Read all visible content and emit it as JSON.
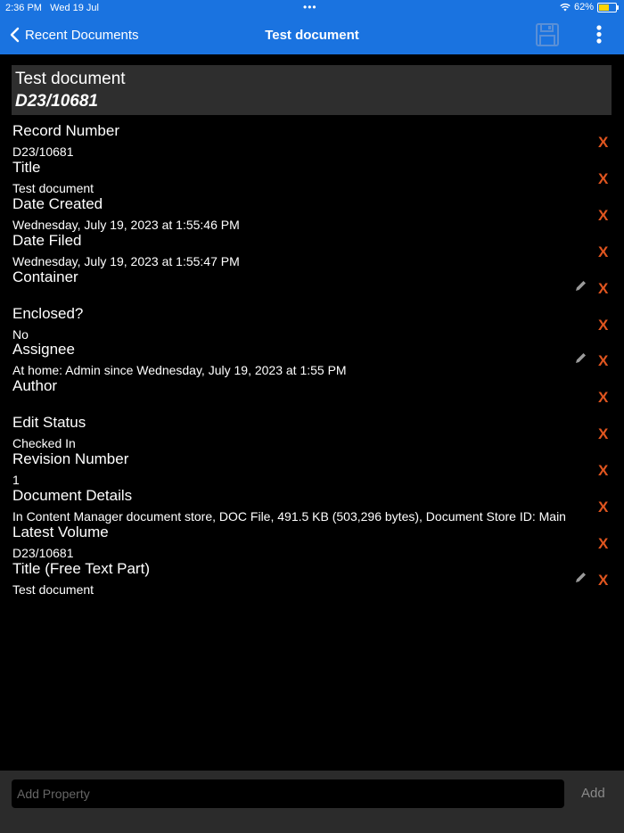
{
  "status_bar": {
    "time": "2:36 PM",
    "date": "Wed 19 Jul",
    "dots": "•••",
    "battery": "62%",
    "battery_level": 0.62
  },
  "nav": {
    "back_label": "Recent Documents",
    "title": "Test document",
    "bar_color": "#1a73e0"
  },
  "header": {
    "title": "Test document",
    "record_number": "D23/10681"
  },
  "properties": [
    {
      "label": "Record Number",
      "value": "D23/10681",
      "editable": false
    },
    {
      "label": "Title",
      "value": "Test document",
      "editable": false
    },
    {
      "label": "Date Created",
      "value": "Wednesday, July 19, 2023 at 1:55:46 PM",
      "editable": false
    },
    {
      "label": "Date Filed",
      "value": "Wednesday, July 19, 2023 at 1:55:47 PM",
      "editable": false
    },
    {
      "label": "Container",
      "value": "",
      "editable": true
    },
    {
      "label": "Enclosed?",
      "value": "No",
      "editable": false
    },
    {
      "label": "Assignee",
      "value": "At home: Admin since Wednesday, July 19, 2023 at 1:55 PM",
      "editable": true
    },
    {
      "label": "Author",
      "value": "",
      "editable": false
    },
    {
      "label": "Edit Status",
      "value": "Checked In",
      "editable": false
    },
    {
      "label": "Revision Number",
      "value": "1",
      "editable": false
    },
    {
      "label": "Document Details",
      "value": "In Content Manager document store, DOC File, 491.5 KB (503,296 bytes), Document Store ID: Main",
      "editable": false
    },
    {
      "label": "Latest Volume",
      "value": "D23/10681",
      "editable": false
    },
    {
      "label": "Title (Free Text Part)",
      "value": "Test document",
      "editable": true
    }
  ],
  "delete_label": "X",
  "delete_color": "#e0551f",
  "add_property": {
    "placeholder": "Add Property",
    "button": "Add"
  }
}
